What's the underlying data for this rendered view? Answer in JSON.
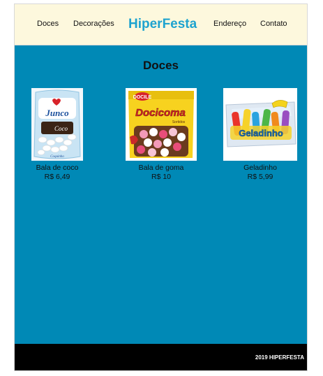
{
  "nav": {
    "left": [
      {
        "label": "Doces"
      },
      {
        "label": "Decorações"
      }
    ],
    "brand": "HiperFesta",
    "right": [
      {
        "label": "Endereço"
      },
      {
        "label": "Contato"
      }
    ]
  },
  "colors": {
    "header_bg": "#fdf8dd",
    "main_bg": "#0089b6",
    "brand": "#1ea3cf",
    "footer_bg": "#000000"
  },
  "section": {
    "title": "Doces"
  },
  "products": [
    {
      "name": "Bala de coco",
      "price": "R$ 6,49",
      "package_text": [
        "Junco",
        "Coco",
        "Coquinho"
      ]
    },
    {
      "name": "Bala de goma",
      "price": "R$ 10",
      "package_text": [
        "DOCILE",
        "Docicoma",
        "Sortidos"
      ]
    },
    {
      "name": "Geladinho",
      "price": "R$ 5,99",
      "package_text": [
        "Geladinho"
      ]
    }
  ],
  "footer": {
    "text": "2019 HIPERFESTA"
  }
}
